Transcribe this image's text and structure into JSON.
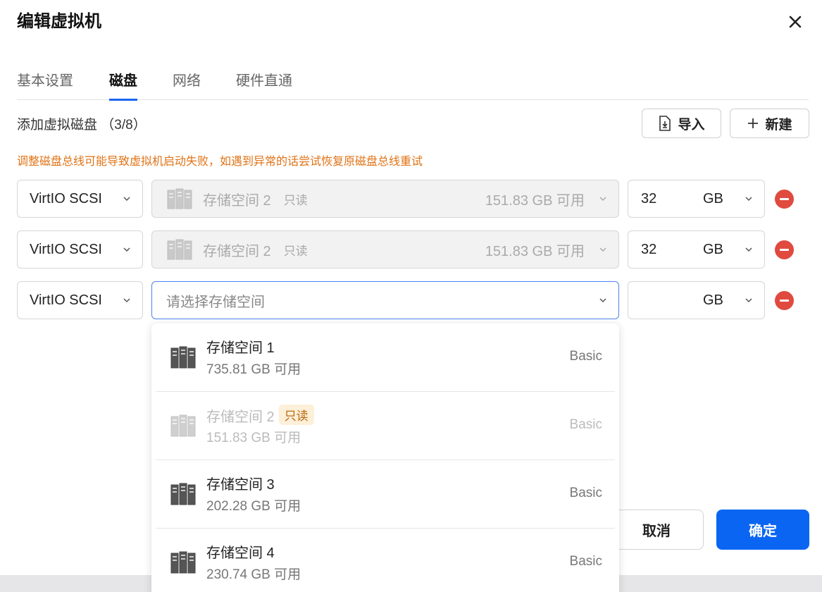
{
  "dialog": {
    "title": "编辑虚拟机",
    "tabs": [
      {
        "label": "基本设置"
      },
      {
        "label": "磁盘"
      },
      {
        "label": "网络"
      },
      {
        "label": "硬件直通"
      }
    ],
    "active_tab": "磁盘"
  },
  "disks": {
    "section_label": "添加虚拟磁盘 （3/8）",
    "import_label": "导入",
    "new_label": "新建",
    "warning": "调整磁盘总线可能导致虚拟机启动失败，如遇到异常的话尝试恢复原磁盘总线重试",
    "rows": [
      {
        "bus": "VirtIO SCSI",
        "storage_name": "存储空间 2",
        "storage_tag": "只读",
        "storage_avail": "151.83 GB 可用",
        "size": "32",
        "unit": "GB"
      },
      {
        "bus": "VirtIO SCSI",
        "storage_name": "存储空间 2",
        "storage_tag": "只读",
        "storage_avail": "151.83 GB 可用",
        "size": "32",
        "unit": "GB"
      },
      {
        "bus": "VirtIO SCSI",
        "storage_placeholder": "请选择存储空间",
        "size": "",
        "unit": "GB"
      }
    ]
  },
  "dropdown": {
    "options": [
      {
        "name": "存储空间 1",
        "capacity": "735.81 GB 可用",
        "type": "Basic",
        "badge": ""
      },
      {
        "name": "存储空间 2",
        "capacity": "151.83 GB 可用",
        "type": "Basic",
        "badge": "只读"
      },
      {
        "name": "存储空间 3",
        "capacity": "202.28 GB 可用",
        "type": "Basic",
        "badge": ""
      },
      {
        "name": "存储空间 4",
        "capacity": "230.74 GB 可用",
        "type": "Basic",
        "badge": ""
      }
    ]
  },
  "footer": {
    "cancel_label": "取消",
    "confirm_label": "确定"
  },
  "colors": {
    "accent": "#0a66f2",
    "warning": "#e07316",
    "danger": "#e04a3f"
  }
}
